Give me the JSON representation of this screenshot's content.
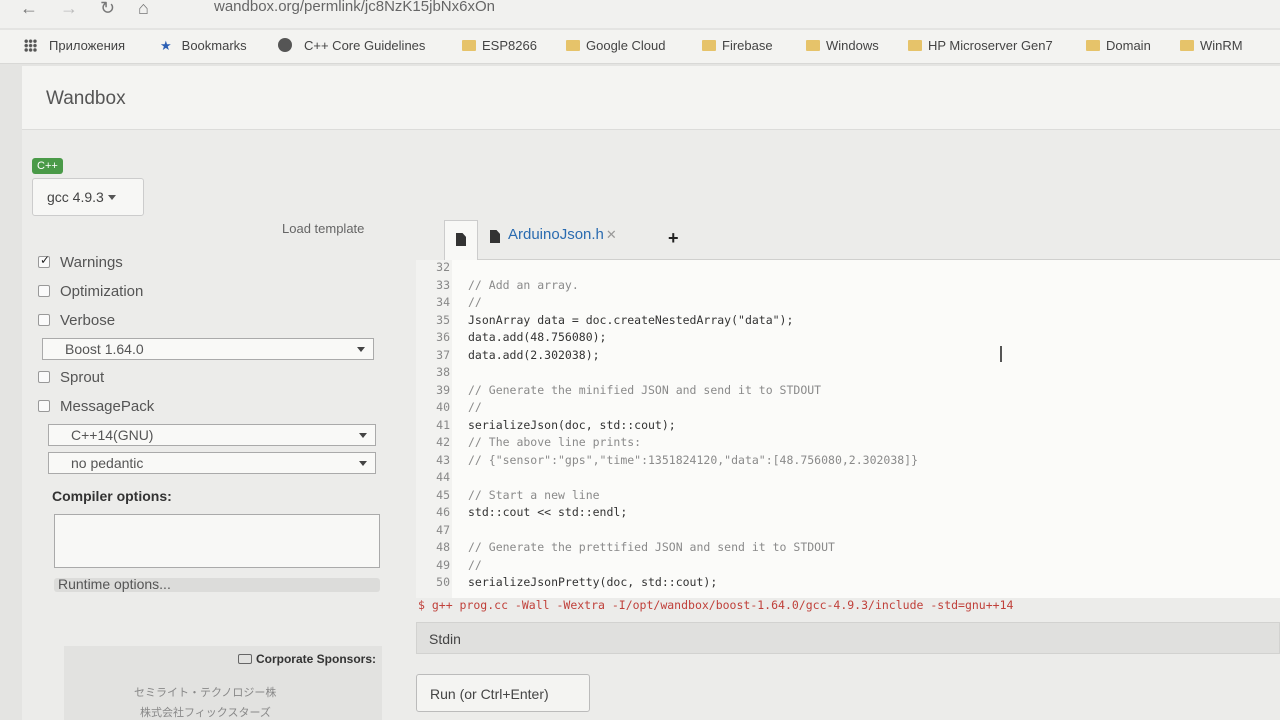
{
  "browser": {
    "url": "wandbox.org/permlink/jc8NzK15jbNx6xOn",
    "bookmarks": [
      {
        "label": "Приложения",
        "icon": "apps-grid-icon"
      },
      {
        "label": "Bookmarks",
        "icon": "star-icon"
      },
      {
        "label": "C++ Core Guidelines",
        "icon": "globe-icon"
      },
      {
        "label": "ESP8266",
        "icon": "folder-icon"
      },
      {
        "label": "Google Cloud",
        "icon": "folder-icon"
      },
      {
        "label": "Firebase",
        "icon": "folder-icon"
      },
      {
        "label": "Windows",
        "icon": "folder-icon"
      },
      {
        "label": "HP Microserver Gen7",
        "icon": "folder-icon"
      },
      {
        "label": "Domain",
        "icon": "folder-icon"
      },
      {
        "label": "WinRM",
        "icon": "folder-icon"
      }
    ]
  },
  "app": {
    "title": "Wandbox",
    "language": "C++",
    "compiler": "gcc 4.9.3",
    "load_template": "Load template"
  },
  "options": {
    "warnings": {
      "label": "Warnings",
      "checked": true
    },
    "optimization": {
      "label": "Optimization",
      "checked": false
    },
    "verbose": {
      "label": "Verbose",
      "checked": false
    },
    "boost": "Boost 1.64.0",
    "sprout": {
      "label": "Sprout",
      "checked": false
    },
    "messagepack": {
      "label": "MessagePack",
      "checked": false
    },
    "std": "C++14(GNU)",
    "pedantic": "no pedantic",
    "compiler_options_label": "Compiler options:",
    "runtime_options_label": "Runtime options..."
  },
  "sponsors": {
    "title": "Corporate Sponsors:",
    "items": [
      "セミライト・テクノロジー株",
      "株式会社フィックスターズ"
    ]
  },
  "editor": {
    "tab_file": "ArduinoJson.h",
    "lines": [
      {
        "n": "32",
        "code": ""
      },
      {
        "n": "33",
        "code": "// Add an array."
      },
      {
        "n": "34",
        "code": "//"
      },
      {
        "n": "35",
        "code": "JsonArray data = doc.createNestedArray(\"data\");"
      },
      {
        "n": "36",
        "code": "data.add(48.756080);"
      },
      {
        "n": "37",
        "code": "data.add(2.302038);"
      },
      {
        "n": "38",
        "code": ""
      },
      {
        "n": "39",
        "code": "// Generate the minified JSON and send it to STDOUT"
      },
      {
        "n": "40",
        "code": "//"
      },
      {
        "n": "41",
        "code": "serializeJson(doc, std::cout);"
      },
      {
        "n": "42",
        "code": "// The above line prints:"
      },
      {
        "n": "43",
        "code": "// {\"sensor\":\"gps\",\"time\":1351824120,\"data\":[48.756080,2.302038]}"
      },
      {
        "n": "44",
        "code": ""
      },
      {
        "n": "45",
        "code": "// Start a new line"
      },
      {
        "n": "46",
        "code": "std::cout << std::endl;"
      },
      {
        "n": "47",
        "code": ""
      },
      {
        "n": "48",
        "code": "// Generate the prettified JSON and send it to STDOUT"
      },
      {
        "n": "49",
        "code": "//"
      },
      {
        "n": "50",
        "code": "serializeJsonPretty(doc, std::cout);"
      }
    ],
    "command": "$ g++ prog.cc -Wall -Wextra -I/opt/wandbox/boost-1.64.0/gcc-4.9.3/include -std=gnu++14"
  },
  "io": {
    "stdin_label": "Stdin",
    "run_label": "Run (or Ctrl+Enter)"
  }
}
